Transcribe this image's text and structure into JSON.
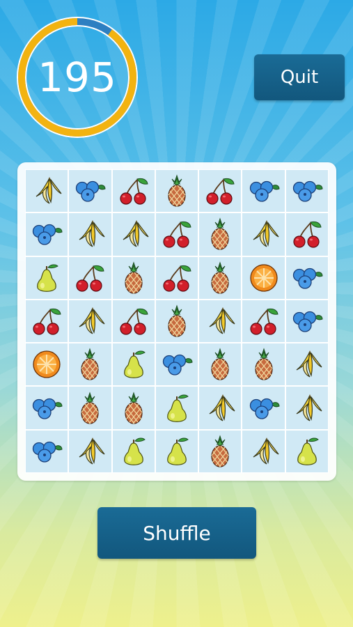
{
  "timer": {
    "value": "195",
    "remaining_fraction": 0.9
  },
  "buttons": {
    "quit": "Quit",
    "shuffle": "Shuffle"
  },
  "board": {
    "rows": [
      [
        "banana",
        "blueberries",
        "cherries",
        "pineapple",
        "cherries",
        "blueberries",
        "blueberries"
      ],
      [
        "blueberries",
        "banana",
        "banana",
        "cherries",
        "pineapple",
        "banana",
        "cherries"
      ],
      [
        "pear",
        "cherries",
        "pineapple",
        "cherries",
        "pineapple",
        "orange",
        "blueberries"
      ],
      [
        "cherries",
        "banana",
        "cherries",
        "pineapple",
        "banana",
        "cherries",
        "blueberries"
      ],
      [
        "orange",
        "pineapple",
        "pear",
        "blueberries",
        "pineapple",
        "pineapple",
        "banana"
      ],
      [
        "blueberries",
        "pineapple",
        "pineapple",
        "pear",
        "banana",
        "blueberries",
        "banana"
      ],
      [
        "blueberries",
        "banana",
        "pear",
        "pear",
        "pineapple",
        "banana",
        "pear"
      ]
    ]
  },
  "colors": {
    "timer_ring": "#f2b311",
    "timer_elapsed": "#2d7fc1",
    "button": "#145f88"
  }
}
